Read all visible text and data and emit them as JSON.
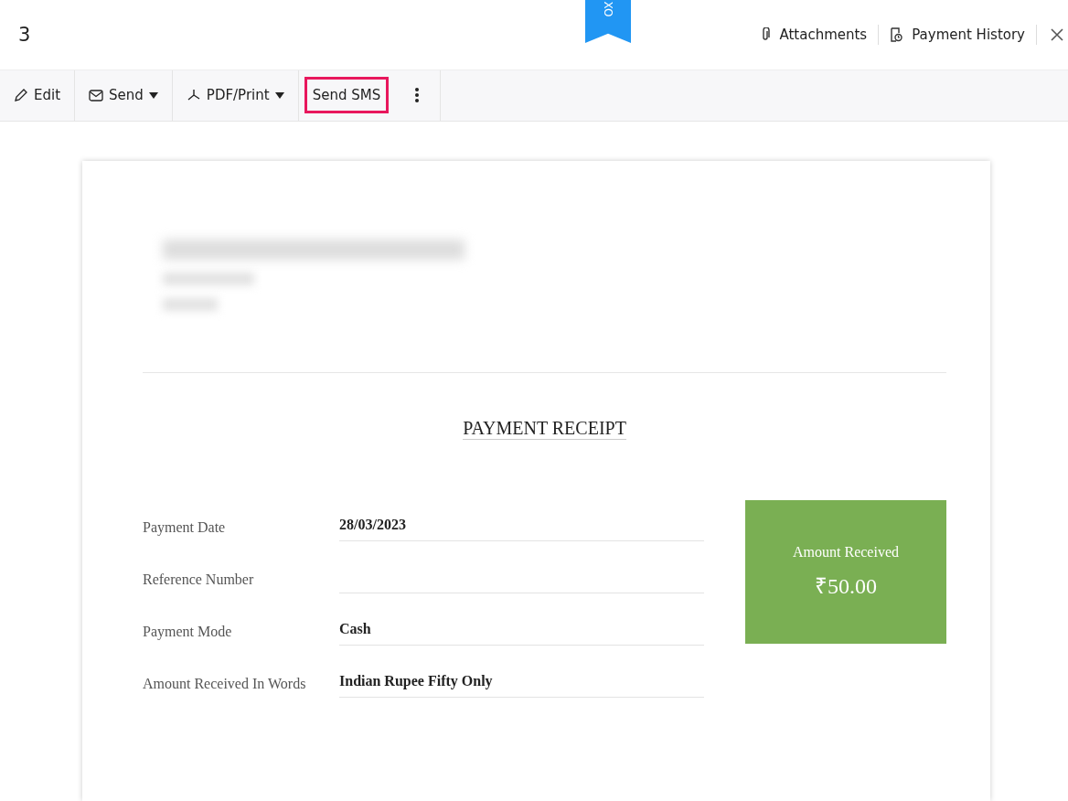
{
  "header": {
    "title": "3",
    "ribbon": "XO",
    "links": [
      {
        "kind": "attachments",
        "label": "Attachments"
      },
      {
        "kind": "history",
        "label": "Payment History"
      }
    ]
  },
  "toolbar": [
    {
      "kind": "edit",
      "label": "Edit",
      "dropdown": false,
      "highlighted": false
    },
    {
      "kind": "send",
      "label": "Send",
      "dropdown": true,
      "highlighted": false
    },
    {
      "kind": "pdf",
      "label": "PDF/Print",
      "dropdown": true,
      "highlighted": false
    },
    {
      "kind": "plain",
      "label": "Send SMS",
      "dropdown": false,
      "highlighted": true
    }
  ],
  "receipt": {
    "title": "PAYMENT RECEIPT",
    "fields": [
      {
        "label": "Payment Date",
        "value": "28/03/2023"
      },
      {
        "label": "Reference Number"
      },
      {
        "label": "Payment Mode",
        "value": "Cash"
      },
      {
        "label": "Amount Received In Words",
        "value": "Indian Rupee Fifty Only"
      }
    ],
    "amount": {
      "label": "Amount Received",
      "value": "₹50.00"
    }
  }
}
